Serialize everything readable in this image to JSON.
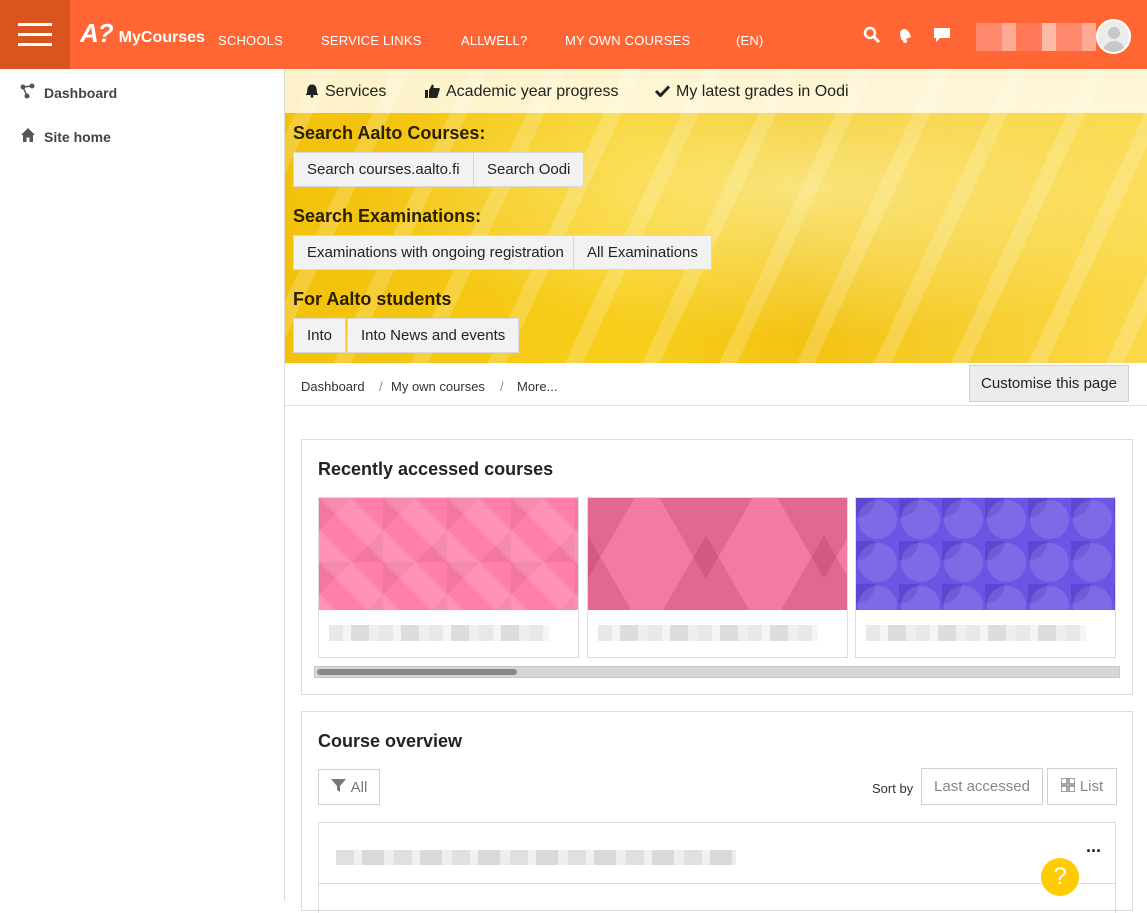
{
  "brand": {
    "logo": "A?",
    "name": "MyCourses"
  },
  "topnav": [
    {
      "label": "SCHOOLS"
    },
    {
      "label": "SERVICE LINKS"
    },
    {
      "label": "ALLWELL?"
    },
    {
      "label": "MY OWN COURSES"
    },
    {
      "label": "(EN)"
    }
  ],
  "nav_icons": [
    "search-icon",
    "bell-icon",
    "chat-icon"
  ],
  "drawer": [
    {
      "label": "Dashboard",
      "icon": "dashboard-icon"
    },
    {
      "label": "Site home",
      "icon": "home-icon"
    }
  ],
  "services_tabs": [
    {
      "label": "Services",
      "icon": "bell-icon"
    },
    {
      "label": "Academic year progress",
      "icon": "thumbs-up-icon"
    },
    {
      "label": "My latest grades in Oodi",
      "icon": "check-icon"
    }
  ],
  "search_courses": {
    "heading": "Search Aalto Courses:",
    "buttons": [
      "Search courses.aalto.fi",
      "Search Oodi"
    ]
  },
  "search_exams": {
    "heading": "Search Examinations:",
    "buttons": [
      "Examinations with ongoing registration",
      "All Examinations"
    ]
  },
  "students": {
    "heading": "For Aalto students",
    "buttons": [
      "Into",
      "Into News and events"
    ]
  },
  "breadcrumb": [
    "Dashboard",
    "My own courses",
    "More..."
  ],
  "breadcrumb_sep": "/",
  "customise_label": "Customise this page",
  "recent": {
    "title": "Recently accessed courses",
    "cards": [
      {
        "pattern": "pink-squares",
        "color": "#ff7eaa"
      },
      {
        "pattern": "pink-triangles",
        "color": "#f27aa4"
      },
      {
        "pattern": "purple-octagons",
        "color": "#6b55e4"
      }
    ]
  },
  "overview": {
    "title": "Course overview",
    "filter_label": "All",
    "sort_by_label": "Sort by",
    "sort_value": "Last accessed",
    "view_label": "List",
    "more_actions": "···"
  },
  "help_label": "?",
  "colors": {
    "brand": "#ff6633",
    "hamburger_bg": "#d9541f",
    "banner": "#f8ce1c",
    "help": "#ffcc00"
  }
}
